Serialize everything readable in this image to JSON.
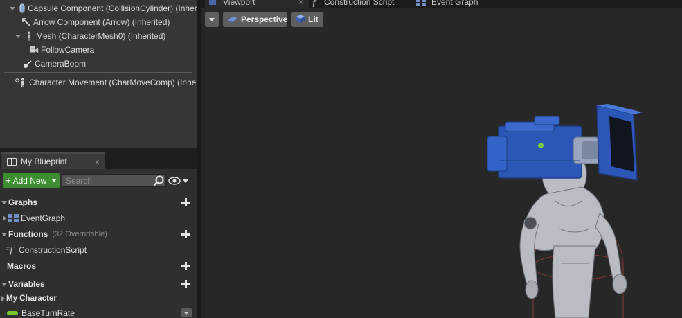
{
  "components": {
    "items": [
      {
        "label": "Capsule Component (CollisionCylinder) (Inherited)",
        "icon": "capsule-icon"
      },
      {
        "label": "Arrow Component (Arrow) (Inherited)",
        "icon": "arrow-icon"
      },
      {
        "label": "Mesh (CharacterMesh0) (Inherited)",
        "icon": "mesh-figure-icon"
      },
      {
        "label": "FollowCamera",
        "icon": "camera-icon"
      },
      {
        "label": "CameraBoom",
        "icon": "spring-arm-icon"
      },
      {
        "label": "Character Movement (CharMoveComp) (Inherited)",
        "icon": "movement-icon"
      }
    ]
  },
  "my_blueprint": {
    "tab_label": "My Blueprint",
    "tab_close": "×",
    "add_new_label": "Add New",
    "search_placeholder": "Search",
    "sections": {
      "graphs": "Graphs",
      "functions": "Functions",
      "functions_sub": "(32 Overridable)",
      "macros": "Macros",
      "variables": "Variables",
      "my_character": "My Character"
    },
    "graphs_items": [
      "EventGraph"
    ],
    "functions_items": [
      "ConstructionScript"
    ],
    "variables_items": [
      "BaseTurnRate"
    ]
  },
  "viewport": {
    "tabs": [
      {
        "label": "Viewport",
        "icon": "viewport-icon",
        "close": "×"
      },
      {
        "label": "Construction Script",
        "icon": "function-icon"
      },
      {
        "label": "Event Graph",
        "icon": "event-graph-icon"
      }
    ],
    "perspective_label": "Perspective",
    "lit_label": "Lit"
  },
  "colors": {
    "add_new_bg": "#3b8f2e",
    "variable_pill": "#79c629",
    "camera_blue": "#2c56b8"
  }
}
